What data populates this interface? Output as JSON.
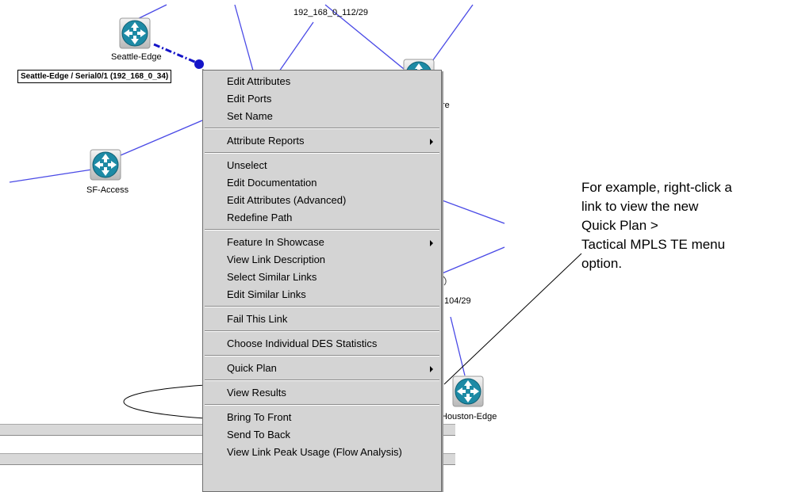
{
  "network": {
    "nodes": {
      "seattle_edge": "Seattle-Edge",
      "sf_access": "SF-Access",
      "houston_edge": "Houston-Edge",
      "partial_node_suffix": "re"
    },
    "link_labels": {
      "top_link": "192_168_0_112/29",
      "lower_link": "104/29"
    },
    "tooltip": "Seattle-Edge / Serial0/1 (192_168_0_34)",
    "link_color": "#4a4ae6",
    "selected_link_color": "#1414c8",
    "router_color": "#1d8aa5"
  },
  "context_menu": {
    "groups": [
      [
        {
          "label": "Edit Attributes"
        },
        {
          "label": "Edit Ports"
        },
        {
          "label": "Set Name"
        }
      ],
      [
        {
          "label": "Attribute Reports",
          "submenu": true
        }
      ],
      [
        {
          "label": "Unselect"
        },
        {
          "label": "Edit Documentation"
        },
        {
          "label": "Edit Attributes (Advanced)"
        },
        {
          "label": "Redefine Path"
        }
      ],
      [
        {
          "label": "Feature In Showcase",
          "submenu": true
        },
        {
          "label": "View Link Description"
        },
        {
          "label": "Select Similar Links"
        },
        {
          "label": "Edit Similar Links"
        }
      ],
      [
        {
          "label": "Fail This Link"
        }
      ],
      [
        {
          "label": "Choose Individual DES Statistics"
        }
      ],
      [
        {
          "label": "Quick Plan",
          "submenu": true
        }
      ],
      [
        {
          "label": "View Results"
        }
      ],
      [
        {
          "label": "Bring To Front"
        },
        {
          "label": "Send To Back"
        },
        {
          "label": "View Link Peak Usage (Flow Analysis)"
        }
      ]
    ]
  },
  "callout": {
    "lines": [
      "For example, right-click a",
      "link to view the new",
      "Quick Plan >",
      "Tactical MPLS TE menu",
      "option."
    ]
  }
}
